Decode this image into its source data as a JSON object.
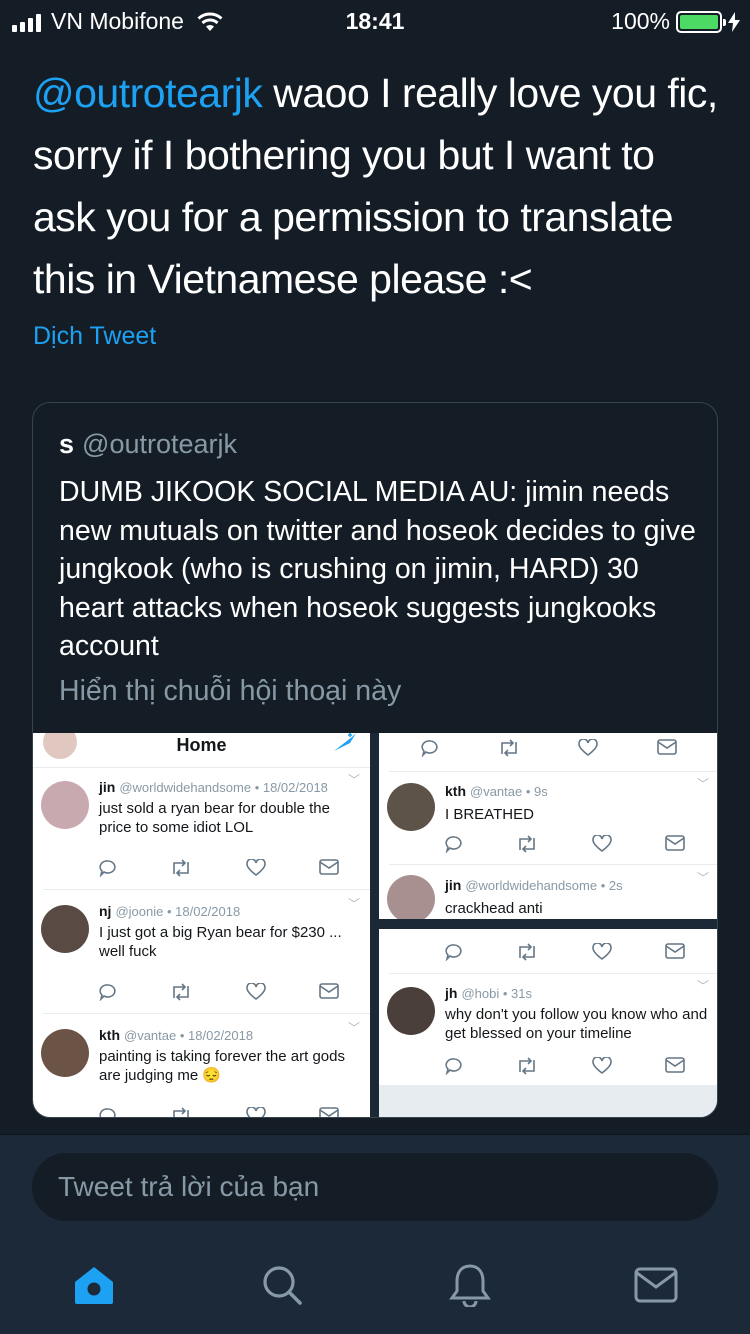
{
  "status_bar": {
    "carrier": "VN Mobifone",
    "time": "18:41",
    "battery": "100%"
  },
  "tweet": {
    "mention": "@outrotearjk",
    "text": " waoo I really love you fic, sorry if I bothering you but I want to ask you for a permission to translate this in Vietnamese please :<",
    "translate_label": "Dịch Tweet"
  },
  "quote": {
    "name": "s",
    "handle": "@outrotearjk",
    "body": "DUMB JIKOOK SOCIAL MEDIA AU: jimin needs new mutuals on twitter and hoseok decides to give jungkook (who is crushing on jimin, HARD) 30 heart attacks when hoseok suggests jungkooks account",
    "thread_label": "Hiển thị chuỗi hội thoại này",
    "image": {
      "home_title": "Home",
      "left_tweets": [
        {
          "name": "jin",
          "handle": "@worldwidehandsome",
          "date": "• 18/02/2018",
          "text": "just sold a ryan bear for double the price to some idiot LOL"
        },
        {
          "name": "nj",
          "handle": "@joonie",
          "date": "• 18/02/2018",
          "text": "I just got a big Ryan bear for $230 ... well fuck"
        },
        {
          "name": "kth",
          "handle": "@vantae",
          "date": "• 18/02/2018",
          "text": "painting is taking forever the art gods are judging me 😔"
        }
      ],
      "right_top_tweets": [
        {
          "name": "kth",
          "handle": "@vantae",
          "date": "• 9s",
          "text": "I BREATHED"
        },
        {
          "name": "jin",
          "handle": "@worldwidehandsome",
          "date": "• 2s",
          "text": "crackhead anti"
        }
      ],
      "right_bottom_tweets": [
        {
          "name": "jh",
          "handle": "@hobi",
          "date": "• 31s",
          "text": "why don't you follow you know who and get blessed on your timeline"
        }
      ]
    }
  },
  "reply": {
    "placeholder": "Tweet trả lời của bạn"
  },
  "tabs": [
    {
      "name": "home",
      "icon": "home-icon",
      "active": true
    },
    {
      "name": "search",
      "icon": "search-icon",
      "active": false
    },
    {
      "name": "notifications",
      "icon": "bell-icon",
      "active": false
    },
    {
      "name": "messages",
      "icon": "mail-icon",
      "active": false
    }
  ],
  "colors": {
    "background": "#141d26",
    "accent": "#1da1f2",
    "muted": "#8899a6",
    "battery": "#4cd964"
  }
}
